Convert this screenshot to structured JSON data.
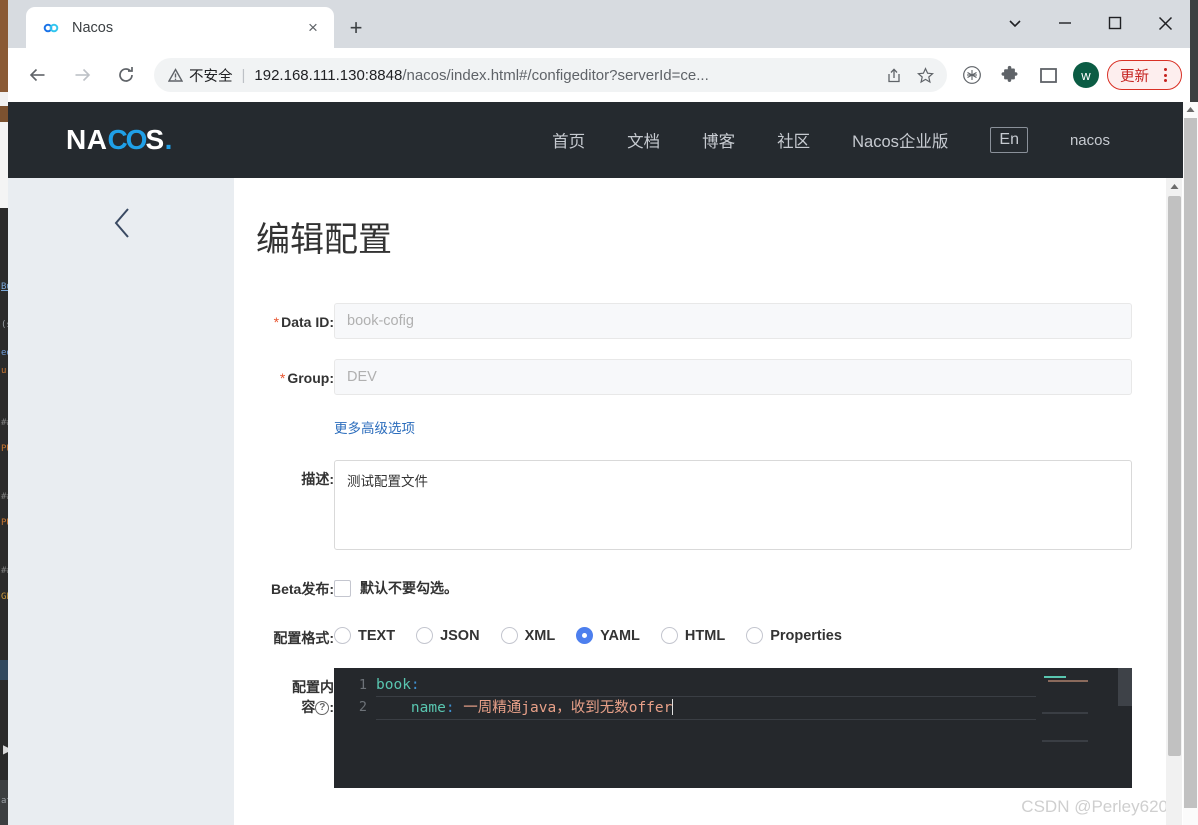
{
  "browser": {
    "tab": {
      "title": "Nacos",
      "favicon": "nacos-infinity-icon",
      "close": "×"
    },
    "new_tab": "+",
    "window_controls": {
      "tab_search": "⌄",
      "minimize": "—",
      "maximize": "□",
      "close": "✕"
    },
    "nav": {
      "back": "←",
      "forward": "→",
      "reload": "⟳"
    },
    "omnibox": {
      "security_label": "不安全",
      "separator": "|",
      "url_host": "192.168.111.130:8848",
      "url_path": "/nacos/index.html#/configeditor?serverId=ce...",
      "share_icon": "share-icon",
      "bookmark_icon": "star-icon"
    },
    "toolbar_icons": [
      "tree-circle-icon",
      "extensions-puzzle-icon",
      "side-panel-icon"
    ],
    "profile_initial": "w",
    "update_button": "更新",
    "menu_icon": "kebab-menu-icon"
  },
  "nacos": {
    "logo": {
      "prefix": "NA",
      "middle": "CO",
      "suffix": "S",
      "dot": "."
    },
    "nav_items": [
      "首页",
      "文档",
      "博客",
      "社区",
      "Nacos企业版"
    ],
    "lang_toggle": "En",
    "user": "nacos",
    "back_chevron": "‹"
  },
  "page": {
    "title": "编辑配置",
    "fields": {
      "data_id": {
        "label": "Data ID:",
        "required": "*",
        "value": "book-cofig"
      },
      "group": {
        "label": "Group:",
        "required": "*",
        "value": "DEV"
      },
      "advanced_link": "更多高级选项",
      "description": {
        "label": "描述:",
        "value": "测试配置文件"
      },
      "beta": {
        "label": "Beta发布:",
        "checkbox_label": "默认不要勾选。",
        "checked": false
      },
      "format": {
        "label": "配置格式:",
        "options": [
          "TEXT",
          "JSON",
          "XML",
          "YAML",
          "HTML",
          "Properties"
        ],
        "selected": "YAML"
      },
      "content": {
        "label_part1": "配置内",
        "label_part2": "容",
        "help_glyph": "?",
        "label_suffix": ":",
        "lines": [
          {
            "num": "1",
            "indent": "",
            "key": "book",
            "colon": ":",
            "value": ""
          },
          {
            "num": "2",
            "indent": "    ",
            "key": "name",
            "colon": ":",
            "value": " 一周精通java，收到无数offer"
          }
        ]
      }
    }
  },
  "watermark": "CSDN @Perley620",
  "colors": {
    "nacos_header_bg": "#252a2f",
    "nacos_accent": "#1fa0e8",
    "radio_selected": "#4d7fee",
    "required_star": "#e8542f",
    "link": "#2d6ebd",
    "editor_bg": "#25282c",
    "editor_key": "#59c6b0",
    "editor_colon": "#3e8fd0",
    "editor_value": "#e8a088",
    "update_border": "#d93025"
  }
}
